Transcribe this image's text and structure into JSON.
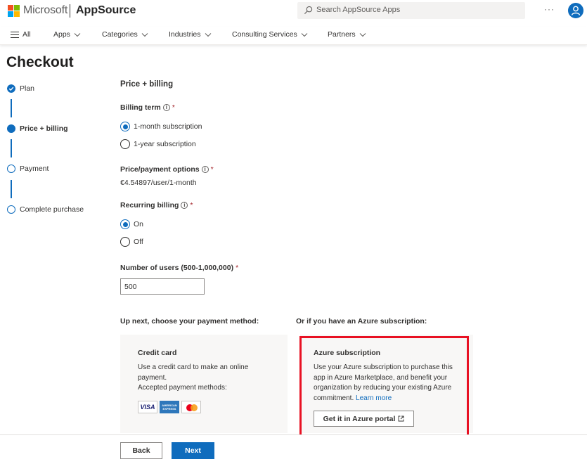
{
  "header": {
    "brand": "Microsoft",
    "product": "AppSource",
    "search_placeholder": "Search AppSource Apps",
    "more_label": "···",
    "logo_colors": [
      "#f25022",
      "#7fba00",
      "#00a4ef",
      "#ffb900"
    ]
  },
  "nav": {
    "all_label": "All",
    "items": [
      {
        "label": "Apps"
      },
      {
        "label": "Categories"
      },
      {
        "label": "Industries"
      },
      {
        "label": "Consulting Services"
      },
      {
        "label": "Partners"
      }
    ]
  },
  "page": {
    "title": "Checkout"
  },
  "steps": [
    {
      "label": "Plan",
      "state": "complete"
    },
    {
      "label": "Price + billing",
      "state": "current"
    },
    {
      "label": "Payment",
      "state": "pending"
    },
    {
      "label": "Complete purchase",
      "state": "pending"
    }
  ],
  "form": {
    "section_title": "Price + billing",
    "billing_term": {
      "label": "Billing term",
      "options": [
        {
          "label": "1-month subscription",
          "selected": true
        },
        {
          "label": "1-year subscription",
          "selected": false
        }
      ]
    },
    "price_options": {
      "label": "Price/payment options",
      "value": "€4.54897/user/1-month"
    },
    "recurring_billing": {
      "label": "Recurring billing",
      "options": [
        {
          "label": "On",
          "selected": true
        },
        {
          "label": "Off",
          "selected": false
        }
      ]
    },
    "users": {
      "label": "Number of users (500-1,000,000)",
      "value": "500"
    },
    "required_mark": "*",
    "info_glyph": "i"
  },
  "payment": {
    "left_heading": "Up next, choose your payment method:",
    "right_heading": "Or if you have an Azure subscription:",
    "credit_card": {
      "title": "Credit card",
      "desc": "Use a credit card to make an online payment.",
      "accepted": "Accepted payment methods:",
      "logos": {
        "visa": "VISA",
        "amex": "AMERICAN EXPRESS"
      }
    },
    "azure": {
      "title": "Azure subscription",
      "desc": "Use your Azure subscription to purchase this app in Azure Marketplace, and benefit your organization by reducing your existing Azure commitment.",
      "learn_more": "Learn more",
      "button": "Get it in Azure portal"
    }
  },
  "footer": {
    "back_label": "Back",
    "next_label": "Next"
  },
  "colors": {
    "accent": "#0f6cbd",
    "highlight": "#e81123"
  }
}
